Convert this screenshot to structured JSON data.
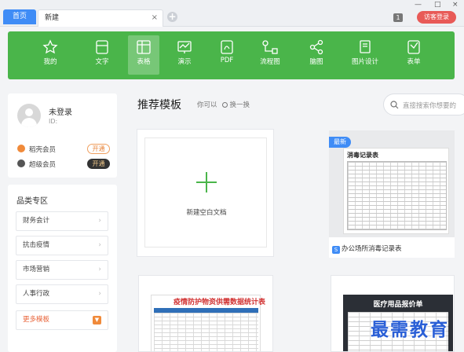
{
  "tabs": {
    "home": "首页",
    "new": "新建",
    "close": "×",
    "add": "+"
  },
  "window": {
    "min": "—",
    "max": "□",
    "close": "×",
    "badge": "1",
    "login": "访客登录"
  },
  "toolbar": {
    "items": [
      {
        "label": "我的",
        "icon": "star-icon"
      },
      {
        "label": "文字",
        "icon": "document-icon"
      },
      {
        "label": "表格",
        "icon": "table-icon",
        "active": true
      },
      {
        "label": "演示",
        "icon": "presentation-icon"
      },
      {
        "label": "PDF",
        "icon": "pdf-icon"
      },
      {
        "label": "流程图",
        "icon": "flowchart-icon"
      },
      {
        "label": "脑图",
        "icon": "mindmap-icon"
      },
      {
        "label": "图片设计",
        "icon": "image-design-icon"
      },
      {
        "label": "表单",
        "icon": "form-icon"
      }
    ],
    "color": "#4ab54a"
  },
  "user": {
    "name": "未登录",
    "id": "ID:",
    "memberships": [
      {
        "label": "稻壳会员",
        "action": "开通",
        "icon_color": "#f08a3a"
      },
      {
        "label": "超级会员",
        "action": "开通",
        "icon_color": "#555555"
      }
    ]
  },
  "categories": {
    "title": "品类专区",
    "items": [
      "财务会计",
      "抗击疫情",
      "市场营销",
      "人事行政"
    ],
    "more": "更多模板"
  },
  "main": {
    "title": "推荐模板",
    "subtitle": "你可以",
    "refresh": "换一换",
    "search_placeholder": "直接搜索你想要的",
    "new_blank": "新建空白文档",
    "template1": {
      "badge": "最新",
      "sheet_title": "消毒记录表",
      "caption": "办公场所消毒记录表"
    },
    "template2_title": "疫情防护物资供需数据统计表",
    "template3_title": "医疗用品报价单"
  },
  "watermark": "最需教育"
}
